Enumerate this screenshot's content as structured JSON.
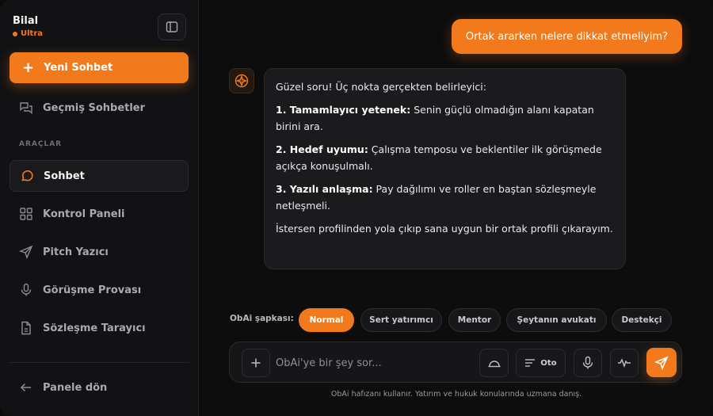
{
  "sidebar": {
    "user_name": "Bilal",
    "user_plan": "Ultra",
    "new_chat_label": "Yeni Sohbet",
    "history_label": "Geçmiş Sohbetler",
    "tools_section": "ARAÇLAR",
    "items": [
      {
        "label": "Sohbet",
        "icon": "chat-bubble-icon",
        "active": true
      },
      {
        "label": "Kontrol Paneli",
        "icon": "dashboard-grid-icon"
      },
      {
        "label": "Pitch Yazıcı",
        "icon": "send-arrow-icon"
      },
      {
        "label": "Görüşme Provası",
        "icon": "microphone-icon"
      },
      {
        "label": "Sözleşme Tarayıcı",
        "icon": "document-icon"
      }
    ],
    "back_label": "Panele dön"
  },
  "chat": {
    "user_message": "Ortak ararken nelere dikkat etmeliyim?",
    "bot": {
      "intro": "Güzel soru! Üç nokta gerçekten belirleyici:",
      "points": [
        {
          "title": "1. Tamamlayıcı yetenek:",
          "text": " Senin güçlü olmadığın alanı kapatan birini ara."
        },
        {
          "title": "2. Hedef uyumu:",
          "text": " Çalışma temposu ve beklentiler ilk görüşmede açıkça konuşulmalı."
        },
        {
          "title": "3. Yazılı anlaşma:",
          "text": " Pay dağılımı ve roller en baştan sözleşmeyle netleşmeli."
        }
      ],
      "outro": "İstersen profilinden yola çıkıp sana uygun bir ortak profili çıkarayım."
    }
  },
  "persona": {
    "label": "ObAi şapkası:",
    "options": [
      "Normal",
      "Sert yatırımcı",
      "Mentor",
      "Şeytanın avukatı",
      "Destekçi"
    ],
    "selected": "Normal"
  },
  "composer": {
    "placeholder": "ObAi'ye bir şey sor...",
    "length_label": "Oto"
  },
  "footer_note": "ObAi hafızanı kullanır. Yatırım ve hukuk konularında uzmana danış.",
  "colors": {
    "accent": "#f27a1c",
    "background": "#0d0d0e",
    "sidebar": "#121214",
    "bubble": "#1b1b1e"
  }
}
